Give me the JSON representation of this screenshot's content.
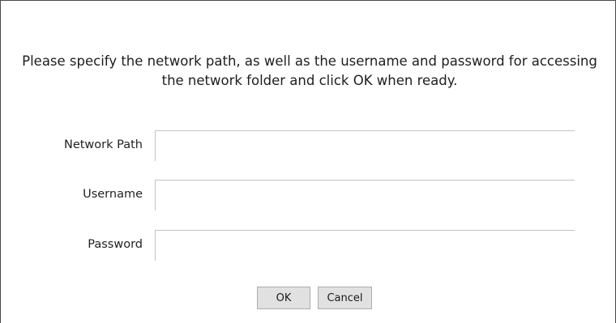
{
  "dialog": {
    "instructions": "Please specify the network path, as well as the username and password for accessing the network folder and click OK when ready.",
    "fields": {
      "network_path": {
        "label": "Network Path",
        "value": ""
      },
      "username": {
        "label": "Username",
        "value": ""
      },
      "password": {
        "label": "Password",
        "value": ""
      }
    },
    "buttons": {
      "ok_label": "OK",
      "cancel_label": "Cancel"
    }
  }
}
